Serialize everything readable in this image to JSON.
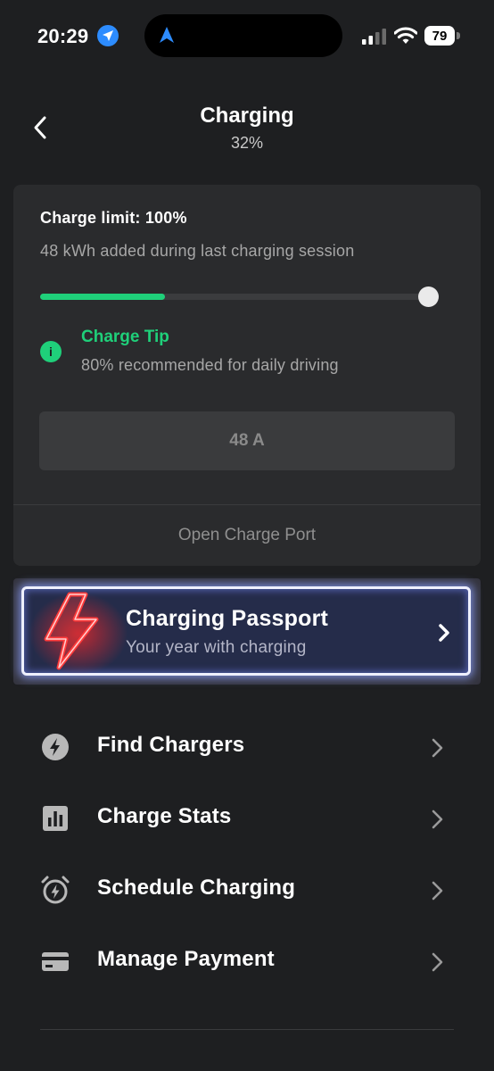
{
  "status_bar": {
    "time": "20:29",
    "battery": "79",
    "icons": [
      "location-arrow-icon",
      "navigation-arrow-icon",
      "cellular-signal-icon",
      "wifi-icon",
      "battery-icon"
    ]
  },
  "header": {
    "title": "Charging",
    "subtitle": "32%",
    "back_icon": "chevron-left-icon"
  },
  "charge_card": {
    "limit_label": "Charge limit: 100%",
    "session_text": "48 kWh added during last charging session",
    "charge_level_fraction": 0.32,
    "limit_fraction": 1.0,
    "tip": {
      "icon": "info-icon",
      "icon_glyph": "i",
      "title": "Charge Tip",
      "text": "80% recommended for daily driving"
    },
    "amps_value": "48 A",
    "open_port_label": "Open Charge Port"
  },
  "passport_banner": {
    "title": "Charging Passport",
    "subtitle": "Your year with charging",
    "icon": "lightning-bolt-icon"
  },
  "menu": [
    {
      "label": "Find Chargers",
      "icon": "lightning-circle-icon"
    },
    {
      "label": "Charge Stats",
      "icon": "bar-chart-icon"
    },
    {
      "label": "Schedule Charging",
      "icon": "alarm-clock-icon"
    },
    {
      "label": "Manage Payment",
      "icon": "credit-card-icon"
    }
  ],
  "colors": {
    "background": "#1e1f21",
    "card": "#2a2b2d",
    "accent_green": "#1fd07a",
    "location_blue": "#2d8cff",
    "bolt_red": "#ff3030"
  }
}
